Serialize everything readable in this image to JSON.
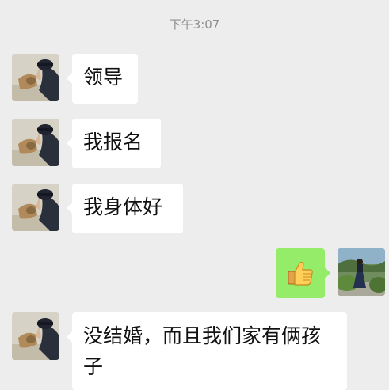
{
  "timestamp": "下午3:07",
  "messages": [
    {
      "text": "领导",
      "side": "left"
    },
    {
      "text": "我报名",
      "side": "left"
    },
    {
      "text": "我身体好",
      "side": "left"
    },
    {
      "icon": "thumbs-up-emoji",
      "side": "right"
    },
    {
      "text": "没结婚，而且我们家有俩孩子",
      "side": "left"
    }
  ],
  "colors": {
    "background": "#ededed",
    "incoming_bubble": "#ffffff",
    "outgoing_bubble": "#95ec69",
    "timestamp_text": "#8f8f8f"
  }
}
